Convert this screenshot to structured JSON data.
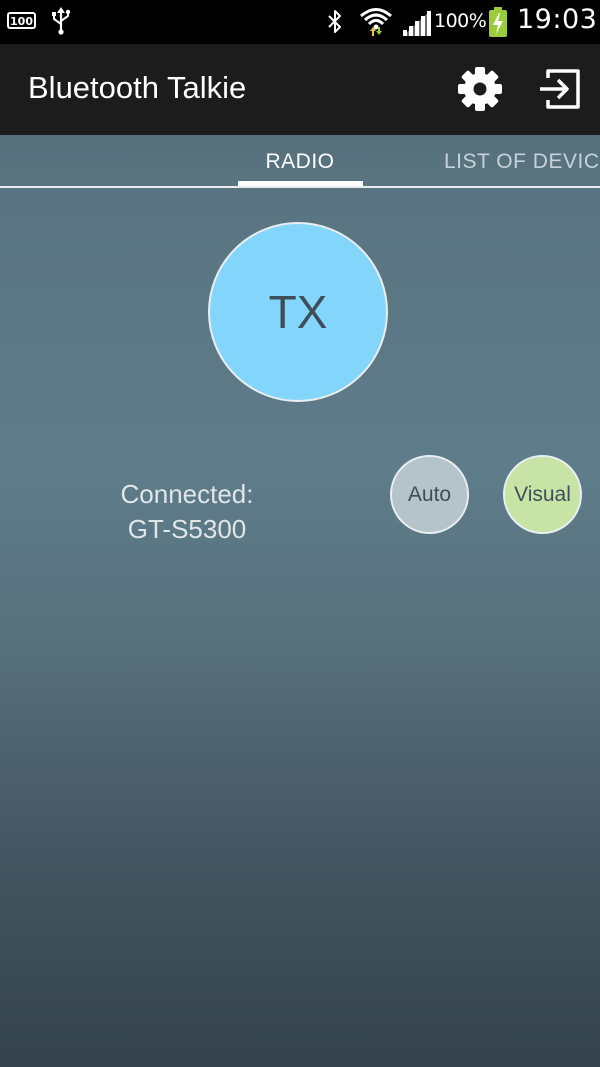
{
  "status_bar": {
    "icons": [
      "storage-100-icon",
      "usb-icon",
      "bluetooth-icon",
      "wifi-icon",
      "signal-icon",
      "battery-charging-icon"
    ],
    "battery_percent": "100%",
    "time": "19:03"
  },
  "action_bar": {
    "title": "Bluetooth Talkie",
    "actions": [
      "settings-icon",
      "exit-icon"
    ]
  },
  "tabs": [
    {
      "label": "RADIO",
      "selected": true
    },
    {
      "label": "LIST OF DEVIC",
      "selected": false
    }
  ],
  "radio": {
    "tx_label": "TX",
    "connection_status": "Connected:",
    "device_name": "GT-S5300",
    "auto_label": "Auto",
    "visual_label": "Visual"
  },
  "colors": {
    "tx_button": "#83d5fb",
    "auto_button": "#b5c3ca",
    "visual_button": "#c7e3a6",
    "action_bar": "#1c1c1c",
    "battery_bolt": "#9ccc3c"
  }
}
